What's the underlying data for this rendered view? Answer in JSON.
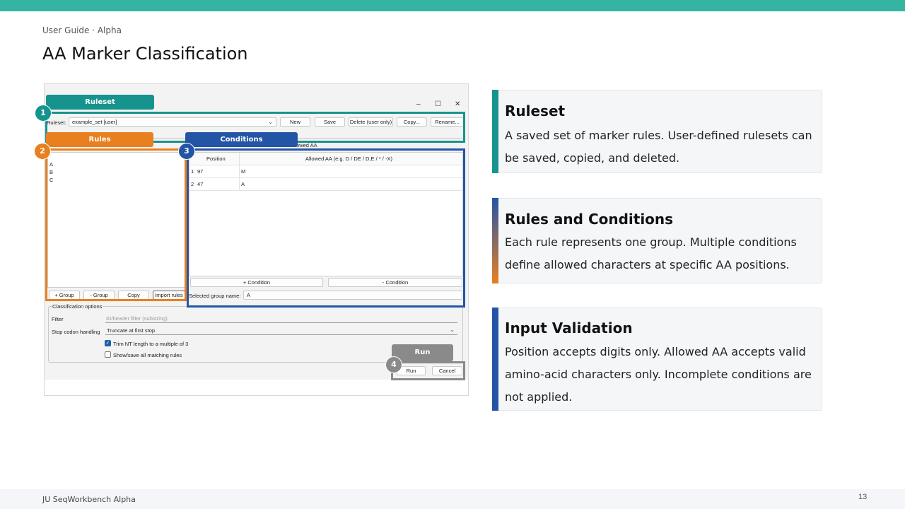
{
  "slide": {
    "kicker": "User Guide · Alpha",
    "title": "AA Marker Classification",
    "footer": "JU SeqWorkbench Alpha",
    "page_number": "13"
  },
  "colors": {
    "teal": "#17938d",
    "orange": "#e8801f",
    "blue": "#2454a6",
    "gray": "#8a8a8a"
  },
  "window": {
    "controls": [
      "–",
      "☐",
      "✕"
    ],
    "ruleset_label": "Ruleset:",
    "ruleset_value": "example_set [user]",
    "buttons": {
      "new": "New",
      "save": "Save",
      "delete": "Delete (user only)",
      "copy": "Copy...",
      "rename": "Rename..."
    },
    "allowed_aa_header_fragment": "owed AA",
    "rules_list": [
      "A",
      "B",
      "C"
    ],
    "rules_buttons": {
      "add_group": "+ Group",
      "remove_group": "- Group",
      "copy": "Copy",
      "import": "Import rules"
    },
    "conditions": {
      "col_position": "Position",
      "col_allowed": "Allowed AA (e.g. D / DE / D,E / * / -X)",
      "rows": [
        {
          "index": "1",
          "position": "97",
          "allowed": "M"
        },
        {
          "index": "2",
          "position": "47",
          "allowed": "A"
        }
      ],
      "add_condition": "+ Condition",
      "remove_condition": "- Condition",
      "group_name_label": "Selected group name:",
      "group_name_value": "A"
    },
    "classification": {
      "legend": "Classification options",
      "filter_label": "Filter",
      "filter_placeholder": "ID/header filter (substring)",
      "stop_label": "Stop codon handling",
      "stop_value": "Truncate at first stop",
      "trim_label": "Trim NT length to a multiple of 3",
      "trim_checked": true,
      "show_label": "Show/save all matching rules",
      "show_checked": false
    },
    "run_button": "Run",
    "cancel_button": "Cancel"
  },
  "annotations": [
    {
      "number": "1",
      "tag": "Ruleset"
    },
    {
      "number": "2",
      "tag": "Rules"
    },
    {
      "number": "3",
      "tag": "Conditions"
    },
    {
      "number": "4",
      "tag": "Run"
    }
  ],
  "cards": [
    {
      "title": "Ruleset",
      "lines": [
        "A saved set of marker rules. User-defined rulesets can",
        "be saved, copied, and deleted."
      ]
    },
    {
      "title": "Rules and Conditions",
      "lines": [
        "Each rule represents one group. Multiple conditions",
        "define allowed characters at specific AA positions."
      ]
    },
    {
      "title": "Input Validation",
      "lines": [
        "Position accepts digits only. Allowed AA accepts valid",
        "amino-acid characters only. Incomplete conditions are",
        "not applied."
      ]
    }
  ]
}
